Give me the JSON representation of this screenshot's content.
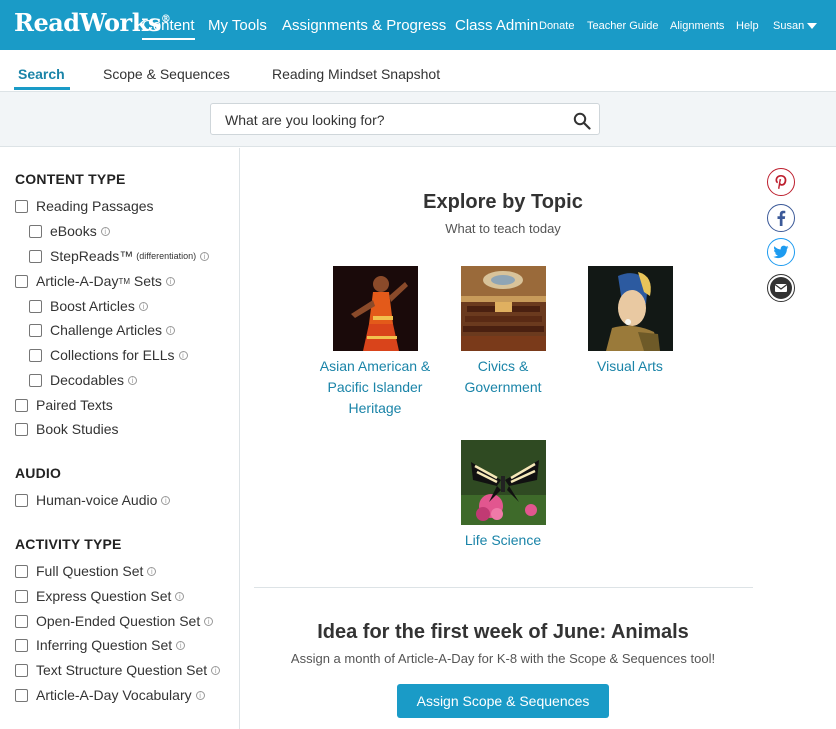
{
  "brand": {
    "logo_text": "ReadWorks",
    "logo_mark": "®"
  },
  "topnav": {
    "content": "Content",
    "my_tools": "My Tools",
    "assignments": "Assignments & Progress",
    "class_admin": "Class Admin",
    "donate": "Donate",
    "teacher_guide": "Teacher Guide",
    "alignments": "Alignments",
    "help": "Help",
    "user": "Susan"
  },
  "subnav": {
    "search": "Search",
    "scope": "Scope & Sequences",
    "mindset": "Reading Mindset Snapshot"
  },
  "search": {
    "placeholder": "What are you looking for?",
    "value": ""
  },
  "sidebar": {
    "content_type": "CONTENT TYPE",
    "reading_passages": "Reading Passages",
    "ebooks": "eBooks",
    "stepreads": "StepReads™",
    "stepreads_note": "(differentiation)",
    "article_a_day": "Article-A-Day",
    "article_a_day_tm": "TM",
    "article_a_day_suffix": " Sets",
    "boost": "Boost Articles",
    "challenge": "Challenge Articles",
    "ells": "Collections for ELLs",
    "decodables": "Decodables",
    "paired": "Paired Texts",
    "book_studies": "Book Studies",
    "audio": "AUDIO",
    "human_voice": "Human-voice Audio",
    "activity_type": "ACTIVITY TYPE",
    "full_q": "Full Question Set",
    "express_q": "Express Question Set",
    "open_q": "Open-Ended Question Set",
    "inferring_q": "Inferring Question Set",
    "text_structure_q": "Text Structure Question Set",
    "vocab": "Article-A-Day Vocabulary",
    "info_glyph": "i"
  },
  "explore": {
    "title": "Explore by Topic",
    "subtitle": "What to teach today",
    "topics": [
      {
        "line1": "Asian American &",
        "line2": "Pacific Islander",
        "line3": "Heritage"
      },
      {
        "line1": "Civics &",
        "line2": "Government"
      },
      {
        "line1": "Visual Arts"
      },
      {
        "line1": "Life Science"
      }
    ]
  },
  "idea": {
    "title": "Idea for the first week of June: Animals",
    "subtitle": "Assign a month of Article-A-Day for K-8 with the Scope & Sequences tool!",
    "button": "Assign Scope & Sequences"
  },
  "share": {
    "icons": [
      "pinterest-icon",
      "facebook-icon",
      "twitter-icon",
      "email-icon"
    ]
  },
  "colors": {
    "brand_blue": "#1a9bc7",
    "link_blue": "#1a84a8"
  }
}
